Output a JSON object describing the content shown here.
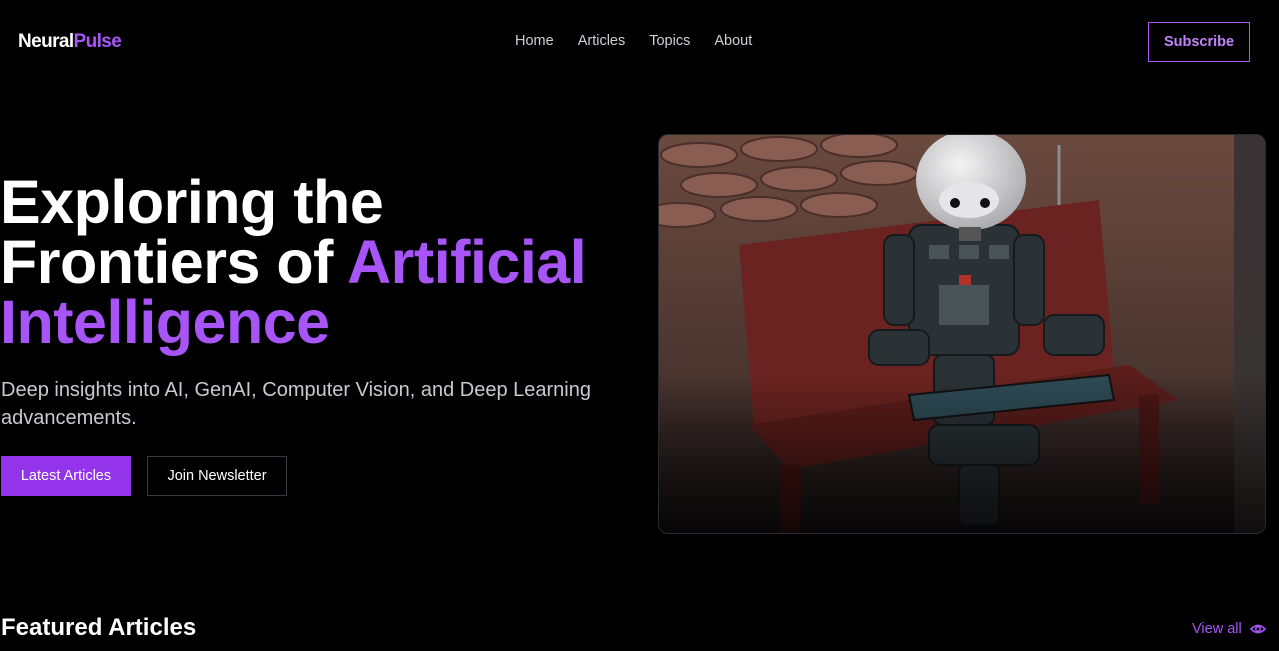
{
  "brand": {
    "name_part1": "Neural",
    "name_part2": "Pulse",
    "accent_color": "#a855f7"
  },
  "nav": {
    "items": [
      {
        "label": "Home"
      },
      {
        "label": "Articles"
      },
      {
        "label": "Topics"
      },
      {
        "label": "About"
      }
    ],
    "subscribe_label": "Subscribe"
  },
  "hero": {
    "title_line1": "Exploring the",
    "title_line2_a": "Frontiers of ",
    "title_line2_b": "Artificial",
    "title_line3": "Intelligence",
    "subtitle": "Deep insights into AI, GenAI, Computer Vision, and Deep Learning advancements.",
    "primary_button": "Latest Articles",
    "secondary_button": "Join Newsletter",
    "image_icon": "robot-on-bench-photo"
  },
  "featured": {
    "title": "Featured Articles",
    "view_all": "View all",
    "view_all_icon": "eye-icon"
  }
}
